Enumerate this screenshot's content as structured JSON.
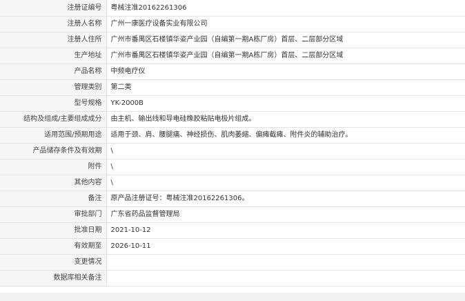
{
  "record": {
    "rows": [
      {
        "label": "注册证编号",
        "value": "粤械注准20162261306"
      },
      {
        "label": "注册人名称",
        "value": "广州一康医疗设备实业有限公司"
      },
      {
        "label": "注册人住所",
        "value": "广州市番禺区石楼镇华姿产业园（自编第一期A栋厂房）首层、二层部分区域"
      },
      {
        "label": "生产地址",
        "value": "广州市番禺区石楼镇华姿产业园（自编第一期A栋厂房）首层、二层部分区域"
      },
      {
        "label": "产品名称",
        "value": "中频电疗仪"
      },
      {
        "label": "管理类别",
        "value": "第二类"
      },
      {
        "label": "型号规格",
        "value": "YK-2000B"
      },
      {
        "label": "结构及组成/主要组成成分",
        "value": "由主机、输出线和导电硅橡胶粘贴电极片组成。"
      },
      {
        "label": "适用范围/预期用途",
        "value": "适用于颈、肩、腰腿痛、神经损伤、肌肉萎缩、偏瘫截瘫、附件炎的辅助治疗。"
      },
      {
        "label": "产品储存条件及有效期",
        "value": "\\"
      },
      {
        "label": "附件",
        "value": "\\"
      },
      {
        "label": "其他内容",
        "value": "\\"
      },
      {
        "label": "备注",
        "value": "原产品注册证号：粤械注准20162261306。"
      },
      {
        "label": "审批部门",
        "value": "广东省药品监督管理局"
      },
      {
        "label": "批准日期",
        "value": "2021-10-12"
      },
      {
        "label": "有效期至",
        "value": "2026-10-11"
      },
      {
        "label": "变更情况",
        "value": ""
      },
      {
        "label": "数据库相关备注",
        "value": ""
      }
    ]
  },
  "colors": {
    "label_background": "#f6f6f6",
    "border": "#e3e3e3",
    "text": "#333333"
  }
}
